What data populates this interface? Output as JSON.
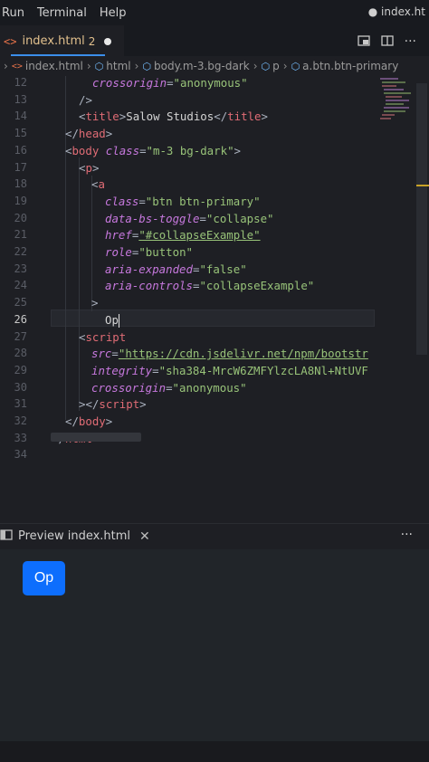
{
  "menubar": {
    "items": [
      "Run",
      "Terminal",
      "Help"
    ],
    "window_title": "● index.ht"
  },
  "tab": {
    "filename": "index.html",
    "problems": "2"
  },
  "breadcrumb": [
    "index.html",
    "html",
    "body.m-3.bg-dark",
    "p",
    "a.btn.btn-primary"
  ],
  "editor": {
    "line_numbers": [
      "12",
      "13",
      "14",
      "15",
      "16",
      "17",
      "18",
      "19",
      "20",
      "21",
      "22",
      "23",
      "24",
      "25",
      "26",
      "27",
      "28",
      "29",
      "30",
      "31",
      "32",
      "33",
      "34"
    ],
    "lines": {
      "l12a": "crossorigin",
      "l12b": "=",
      "l12c": "\"anonymous\"",
      "l13": "/>",
      "l14a": "<",
      "l14b": "title",
      "l14c": ">",
      "l14d": "Salow Studios",
      "l14e": "</",
      "l14f": "title",
      "l14g": ">",
      "l15a": "</",
      "l15b": "head",
      "l15c": ">",
      "l16a": "<",
      "l16b": "body",
      "l16c": " class",
      "l16d": "=",
      "l16e": "\"m-3 bg-dark\"",
      "l16f": ">",
      "l17a": "<",
      "l17b": "p",
      "l17c": ">",
      "l18a": "<",
      "l18b": "a",
      "l19a": "class",
      "l19b": "=",
      "l19c": "\"btn btn-primary\"",
      "l20a": "data-bs-toggle",
      "l20b": "=",
      "l20c": "\"collapse\"",
      "l21a": "href",
      "l21b": "=",
      "l21c": "\"#collapseExample\"",
      "l22a": "role",
      "l22b": "=",
      "l22c": "\"button\"",
      "l23a": "aria-expanded",
      "l23b": "=",
      "l23c": "\"false\"",
      "l24a": "aria-controls",
      "l24b": "=",
      "l24c": "\"collapseExample\"",
      "l25": ">",
      "l26": "Op",
      "l27a": "<",
      "l27b": "script",
      "l28a": "src",
      "l28b": "=",
      "l28c": "\"https://cdn.jsdelivr.net/npm/bootstr",
      "l29a": "integrity",
      "l29b": "=",
      "l29c": "\"sha384-MrcW6ZMFYlzcLA8Nl+NtUVF",
      "l30a": "crossorigin",
      "l30b": "=",
      "l30c": "\"anonymous\"",
      "l31a": "></",
      "l31b": "script",
      "l31c": ">",
      "l32a": "</",
      "l32b": "body",
      "l32c": ">",
      "l33a": "</",
      "l33b": "html",
      "l33c": ">"
    },
    "current_line": "26"
  },
  "preview": {
    "title": "Preview index.html",
    "button_label": "Op"
  },
  "colors": {
    "accent": "#3b8eea",
    "bootstrap_primary": "#0d6efd",
    "tag": "#e06c75",
    "attr": "#c678dd",
    "string": "#98c379"
  },
  "icons": {
    "tab": "code-icon",
    "split": "split-editor-icon",
    "preview": "open-preview-icon",
    "close": "close-icon",
    "more": "more-icon"
  }
}
